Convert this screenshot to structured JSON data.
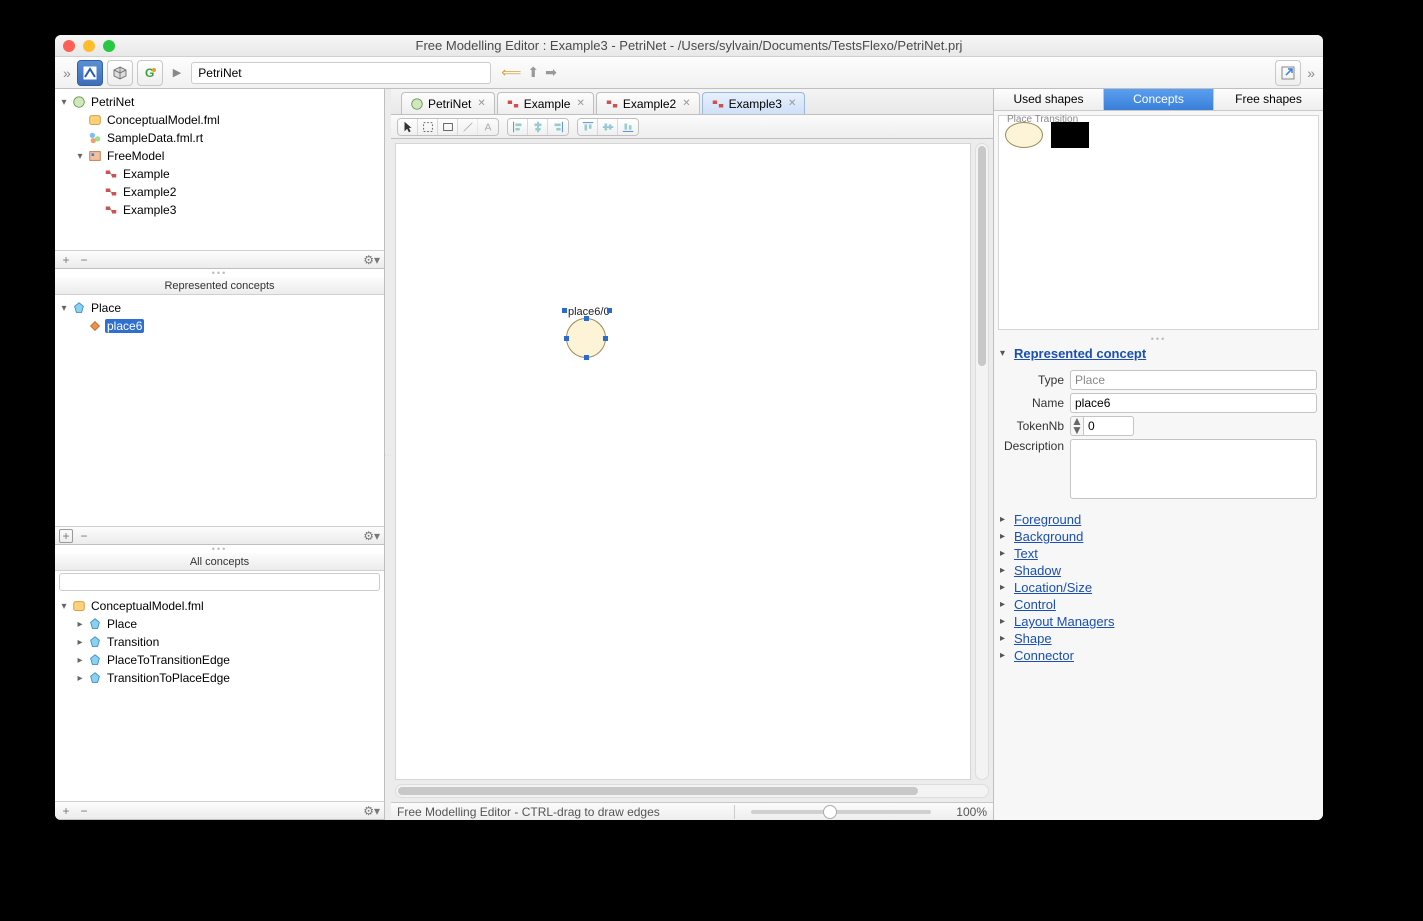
{
  "window": {
    "title": "Free Modelling Editor : Example3 - PetriNet - /Users/sylvain/Documents/TestsFlexo/PetriNet.prj"
  },
  "breadcrumb": {
    "value": "PetriNet"
  },
  "project_tree": {
    "root": "PetriNet",
    "items": [
      {
        "label": "ConceptualModel.fml",
        "indent": 1,
        "icon": "model"
      },
      {
        "label": "SampleData.fml.rt",
        "indent": 1,
        "icon": "data"
      },
      {
        "label": "FreeModel",
        "indent": 1,
        "icon": "freemodel",
        "expandable": true
      },
      {
        "label": "Example",
        "indent": 2,
        "icon": "diagram"
      },
      {
        "label": "Example2",
        "indent": 2,
        "icon": "diagram"
      },
      {
        "label": "Example3",
        "indent": 2,
        "icon": "diagram"
      }
    ]
  },
  "represented_concepts": {
    "title": "Represented concepts",
    "root": "Place",
    "items": [
      {
        "label": "place6",
        "selected": true
      }
    ]
  },
  "all_concepts": {
    "title": "All concepts",
    "root": "ConceptualModel.fml",
    "items": [
      {
        "label": "Place"
      },
      {
        "label": "Transition"
      },
      {
        "label": "PlaceToTransitionEdge"
      },
      {
        "label": "TransitionToPlaceEdge"
      }
    ]
  },
  "editor_tabs": [
    {
      "label": "PetriNet",
      "icon": "project"
    },
    {
      "label": "Example",
      "icon": "diagram"
    },
    {
      "label": "Example2",
      "icon": "diagram"
    },
    {
      "label": "Example3",
      "icon": "diagram",
      "active": true
    }
  ],
  "canvas": {
    "node_label": "place6/0"
  },
  "status": {
    "hint": "Free Modelling Editor - CTRL-drag to draw edges",
    "zoom": "100%"
  },
  "right_tabs": [
    {
      "label": "Used shapes"
    },
    {
      "label": "Concepts",
      "active": true
    },
    {
      "label": "Free shapes"
    }
  ],
  "palette": {
    "heading": "Place Transition"
  },
  "properties": {
    "section_open": "Represented concept",
    "fields": {
      "type_label": "Type",
      "type_value": "Place",
      "name_label": "Name",
      "name_value": "place6",
      "token_label": "TokenNb",
      "token_value": "0",
      "desc_label": "Description",
      "desc_value": ""
    },
    "sections": [
      "Foreground",
      "Background",
      "Text",
      "Shadow",
      "Location/Size",
      "Control",
      "Layout Managers",
      "Shape",
      "Connector"
    ]
  }
}
